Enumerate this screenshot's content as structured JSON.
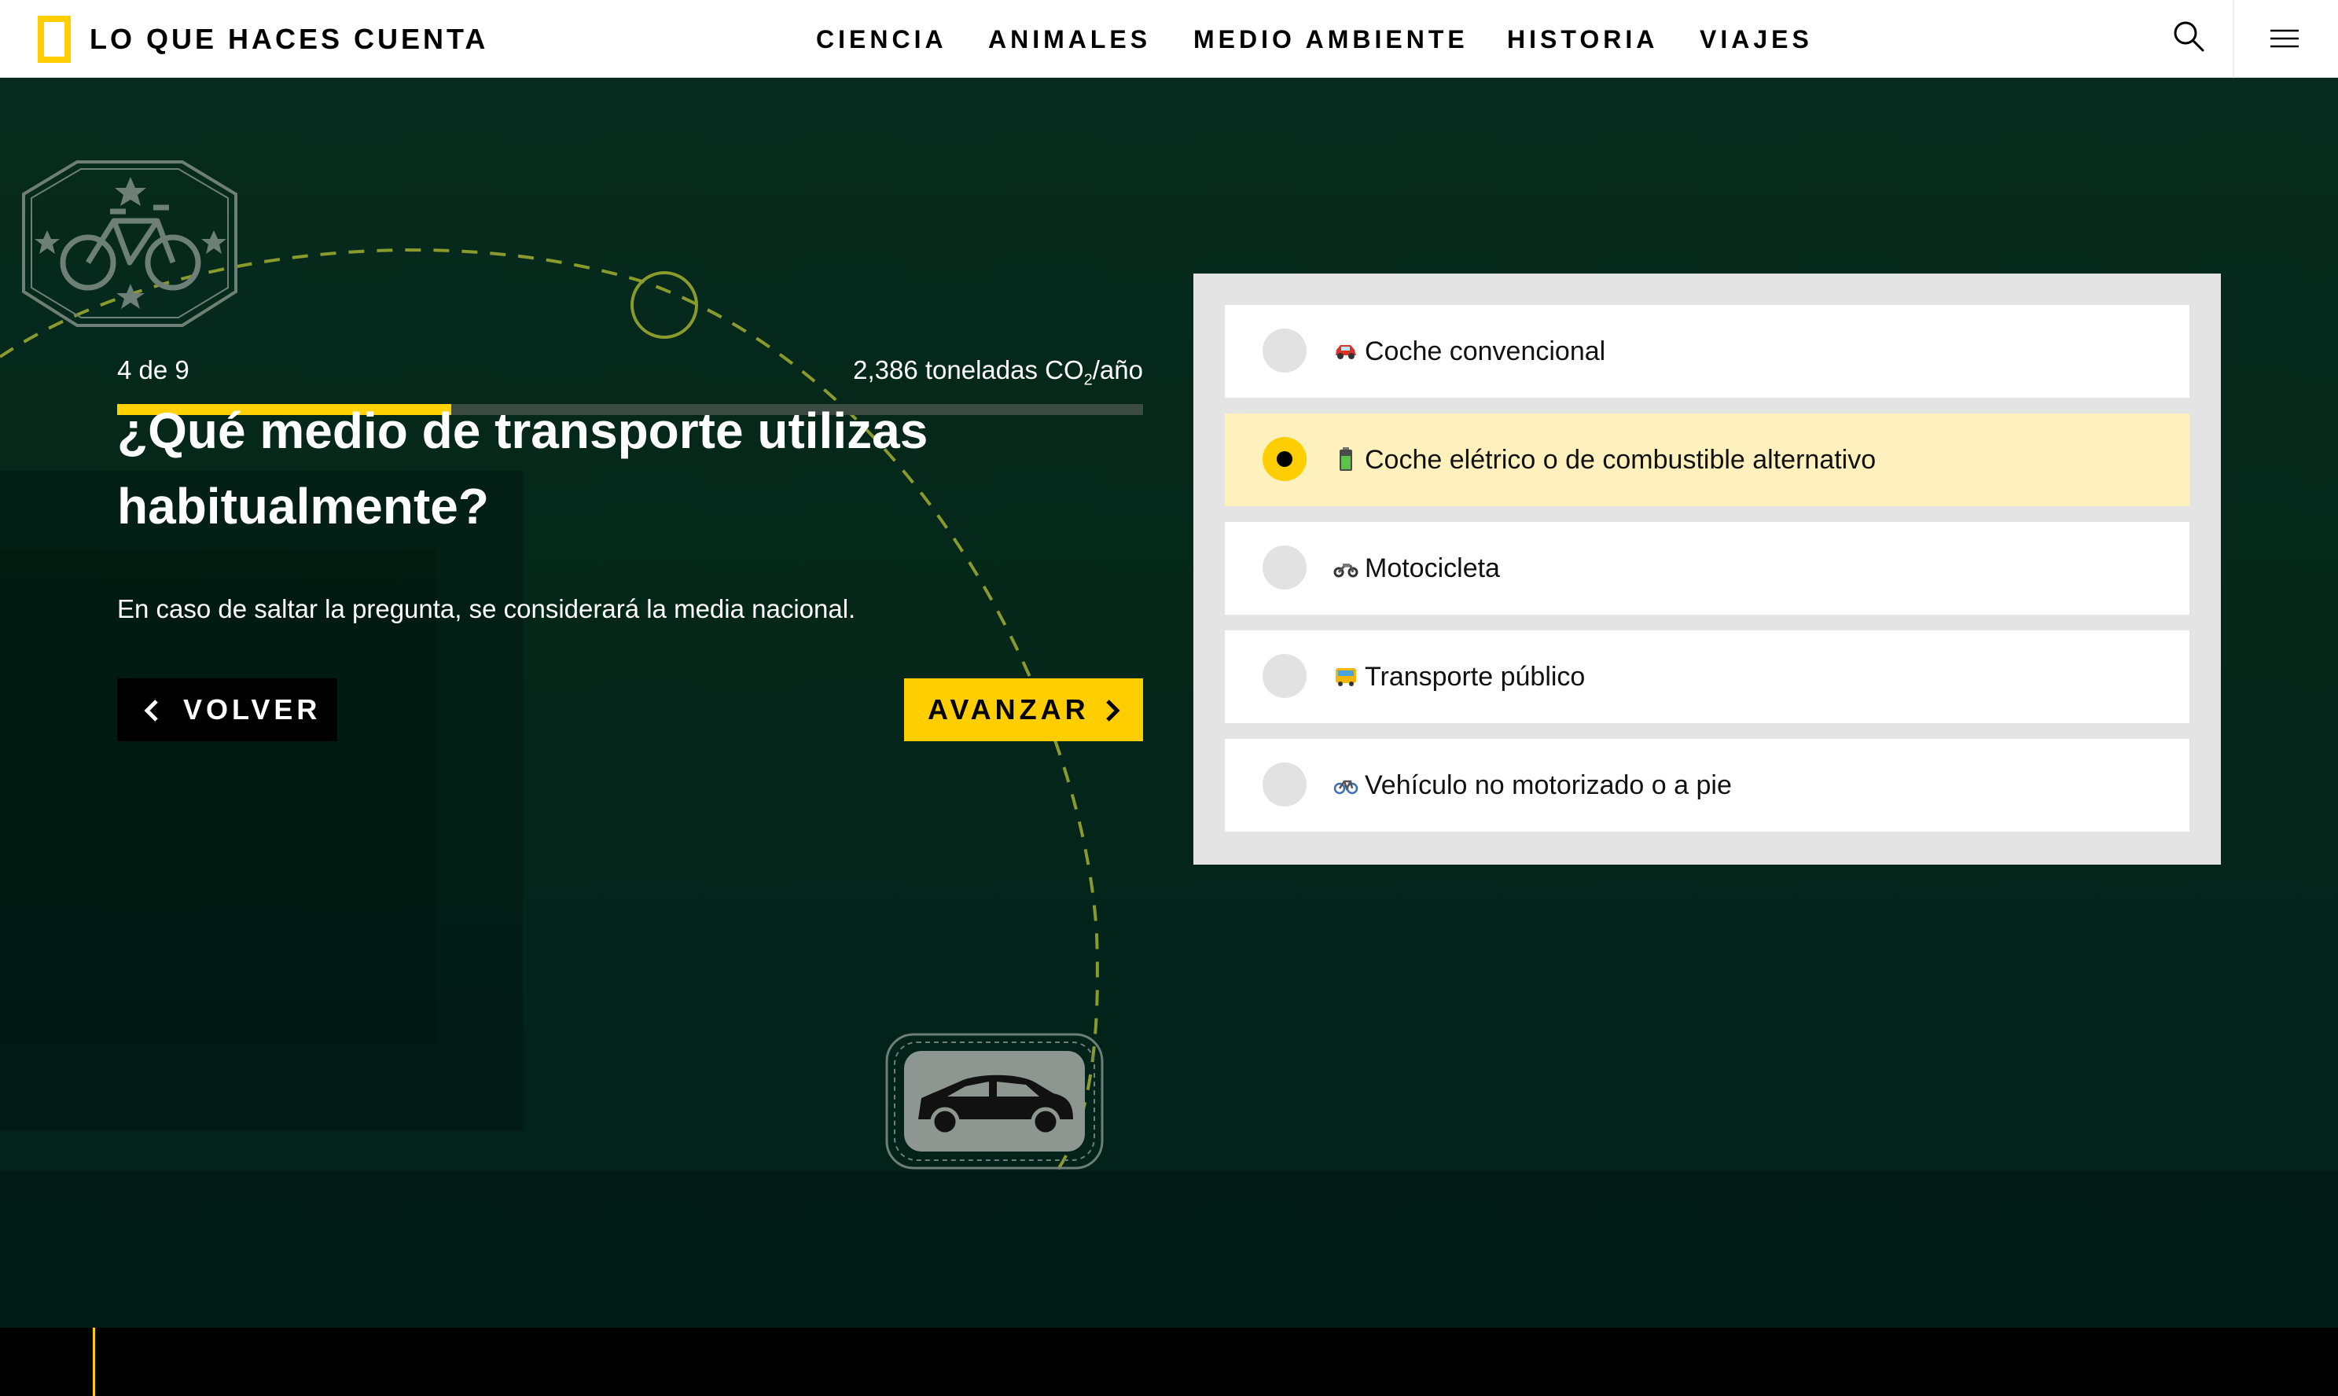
{
  "header": {
    "site_name": "LO QUE HACES CUENTA",
    "nav": [
      "CIENCIA",
      "ANIMALES",
      "MEDIO AMBIENTE",
      "HISTORIA",
      "VIAJES"
    ],
    "search_icon": "search-icon",
    "menu_icon": "hamburger-menu-icon"
  },
  "quiz": {
    "progress_text": "4 de 9",
    "progress_fraction": 0.326,
    "emissions_amount": "2,386 toneladas CO",
    "emissions_sub": "2",
    "emissions_unit": "/año",
    "question": "¿Qué medio de transporte utilizas habitualmente?",
    "hint": "En caso de saltar la pregunta, se considerará la media nacional.",
    "back_label": "VOLVER",
    "next_label": "AVANZAR"
  },
  "options": [
    {
      "label": "Coche convencional",
      "icon": "car-icon",
      "selected": false
    },
    {
      "label": "Coche elétrico o de combustible alternativo",
      "icon": "battery-icon",
      "selected": true
    },
    {
      "label": "Motocicleta",
      "icon": "motorcycle-icon",
      "selected": false
    },
    {
      "label": "Transporte público",
      "icon": "bus-icon",
      "selected": false
    },
    {
      "label": "Vehículo no motorizado o a pie",
      "icon": "bicycle-icon",
      "selected": false
    }
  ],
  "colors": {
    "accent": "#ffce00",
    "background": "#04271a",
    "selected_option": "#fef1bd",
    "panel": "#e4e4e4"
  }
}
